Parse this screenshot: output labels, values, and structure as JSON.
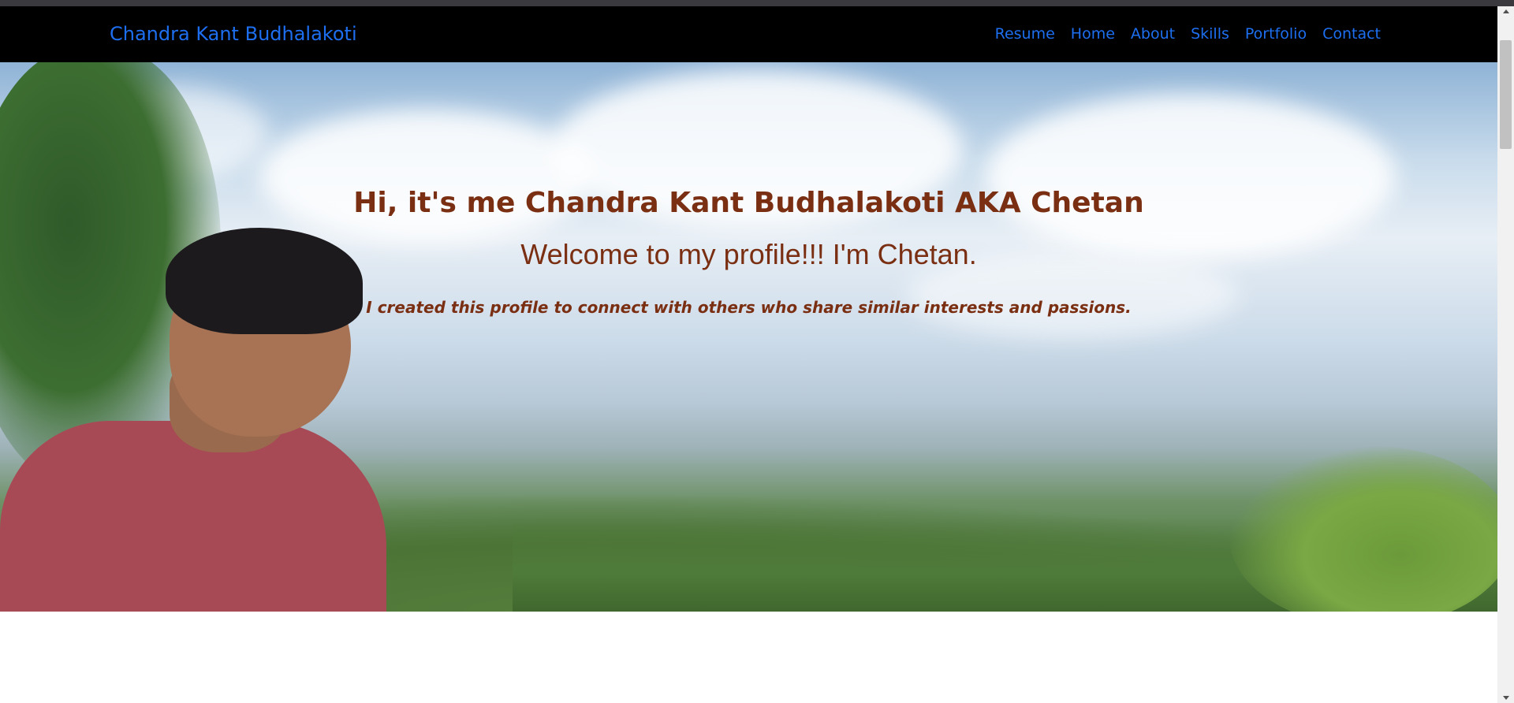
{
  "navbar": {
    "brand": "Chandra Kant Budhalakoti",
    "links": [
      "Resume",
      "Home",
      "About",
      "Skills",
      "Portfolio",
      "Contact"
    ]
  },
  "hero": {
    "heading": "Hi, it's me Chandra Kant Budhalakoti AKA Chetan",
    "subheading": "Welcome to my profile!!! I'm Chetan.",
    "tagline": "I created this profile to connect with others who share similar interests and passions."
  },
  "colors": {
    "navbar_bg": "#000000",
    "link": "#1e6ff0",
    "hero_text": "#7a2e12"
  }
}
